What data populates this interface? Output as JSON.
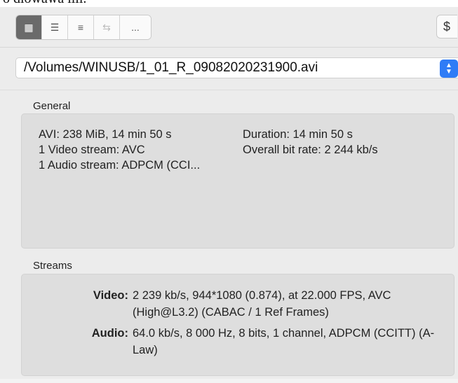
{
  "top_clip_text": "o diowawa iiii.",
  "toolbar": {
    "buttons": [
      {
        "icon": "grid-view-icon",
        "glyph": "▦"
      },
      {
        "icon": "outline-list-icon",
        "glyph": "☰"
      },
      {
        "icon": "text-list-icon",
        "glyph": "≡"
      },
      {
        "icon": "swap-arrows-icon",
        "glyph": "⇆"
      },
      {
        "label": "..."
      }
    ],
    "dollar_label": "$"
  },
  "file": {
    "path": "/Volumes/WINUSB/1_01_R_09082020231900.avi"
  },
  "general": {
    "title": "General",
    "left": [
      "AVI: 238 MiB, 14 min 50 s",
      "1 Video stream: AVC",
      "1 Audio stream: ADPCM (CCI..."
    ],
    "right": [
      "Duration: 14 min 50 s",
      "Overall bit rate: 2 244 kb/s"
    ]
  },
  "streams": {
    "title": "Streams",
    "items": [
      {
        "key": "Video:",
        "value": "2 239 kb/s, 944*1080 (0.874), at 22.000 FPS, AVC (High@L3.2) (CABAC / 1 Ref Frames)"
      },
      {
        "key": "Audio:",
        "value": "64.0 kb/s, 8 000 Hz, 8 bits, 1 channel, ADPCM (CCITT) (A-Law)"
      }
    ]
  },
  "colors": {
    "accent": "#2f7cf6",
    "active_button": "#6a6a6a",
    "panel": "#dedede"
  }
}
